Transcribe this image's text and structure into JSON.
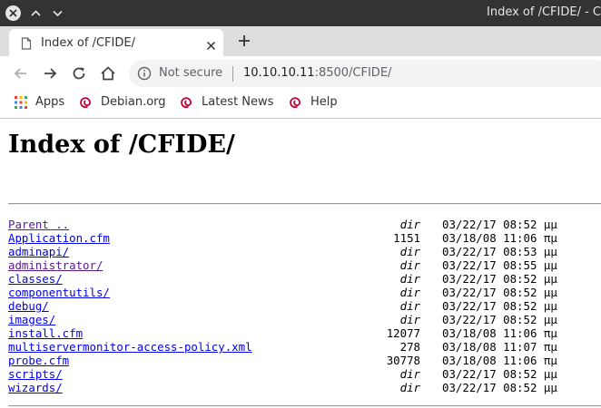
{
  "window": {
    "title": "Index of /CFIDE/ - C"
  },
  "tab": {
    "title": "Index of /CFIDE/"
  },
  "omnibox": {
    "security_label": "Not secure",
    "url_host": "10.10.10.11",
    "url_rest": ":8500/CFIDE/"
  },
  "bookmarks": [
    {
      "label": "Apps",
      "icon": "apps-grid-icon"
    },
    {
      "label": "Debian.org",
      "icon": "debian-swirl-icon"
    },
    {
      "label": "Latest News",
      "icon": "debian-swirl-icon"
    },
    {
      "label": "Help",
      "icon": "debian-swirl-icon"
    }
  ],
  "page": {
    "heading": "Index of /CFIDE/",
    "entries": [
      {
        "name": "Parent ..",
        "size": "dir",
        "date": "03/22/17 08:52 μμ",
        "visited": true
      },
      {
        "name": "Application.cfm",
        "size": "1151",
        "date": "03/18/08 11:06 πμ",
        "visited": false
      },
      {
        "name": "adminapi/",
        "size": "dir",
        "date": "03/22/17 08:53 μμ",
        "visited": false
      },
      {
        "name": "administrator/",
        "size": "dir",
        "date": "03/22/17 08:55 μμ",
        "visited": true
      },
      {
        "name": "classes/",
        "size": "dir",
        "date": "03/22/17 08:52 μμ",
        "visited": false
      },
      {
        "name": "componentutils/",
        "size": "dir",
        "date": "03/22/17 08:52 μμ",
        "visited": false
      },
      {
        "name": "debug/",
        "size": "dir",
        "date": "03/22/17 08:52 μμ",
        "visited": false
      },
      {
        "name": "images/",
        "size": "dir",
        "date": "03/22/17 08:52 μμ",
        "visited": false
      },
      {
        "name": "install.cfm",
        "size": "12077",
        "date": "03/18/08 11:06 πμ",
        "visited": false
      },
      {
        "name": "multiservermonitor-access-policy.xml",
        "size": "278",
        "date": "03/18/08 11:07 πμ",
        "visited": false
      },
      {
        "name": "probe.cfm",
        "size": "30778",
        "date": "03/18/08 11:06 πμ",
        "visited": false
      },
      {
        "name": "scripts/",
        "size": "dir",
        "date": "03/22/17 08:52 μμ",
        "visited": false
      },
      {
        "name": "wizards/",
        "size": "dir",
        "date": "03/22/17 08:52 μμ",
        "visited": false
      }
    ]
  },
  "colors": {
    "link": "#0000ee",
    "visited_link": "#551a8b",
    "titlebar": "#333333",
    "debian_red": "#c70036"
  }
}
